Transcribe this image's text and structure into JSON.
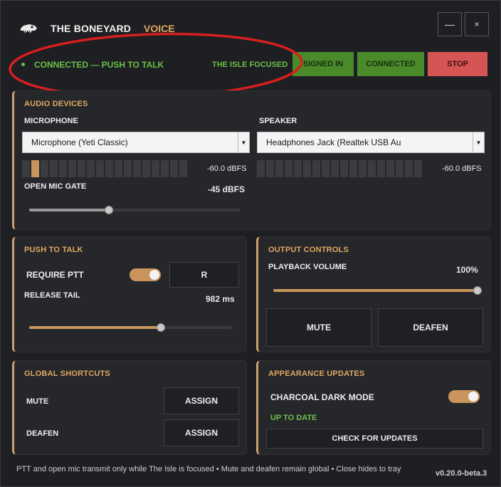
{
  "header": {
    "logo_icon": "dinosaur-skull-icon",
    "title": "THE BONEYARD",
    "subtitle": "VOICE",
    "minimize_label": "—",
    "close_label": "×"
  },
  "status": {
    "connection_text": "CONNECTED — PUSH TO TALK",
    "focus_text": "THE ISLE FOCUSED",
    "signed_in_label": "SIGNED IN",
    "connected_label": "CONNECTED",
    "stop_label": "STOP"
  },
  "audio_devices": {
    "title": "AUDIO DEVICES",
    "microphone_label": "MICROPHONE",
    "microphone_value": "Microphone (Yeti Classic)",
    "speaker_label": "SPEAKER",
    "speaker_value": "Headphones Jack (Realtek USB Au",
    "mic_level_text": "-60.0 dBFS",
    "mic_meter_active_segments": 1,
    "mic_meter_total_segments": 18,
    "speaker_level_text": "-60.0 dBFS",
    "speaker_meter_active_segments": 0,
    "speaker_meter_total_segments": 18,
    "gate_label": "OPEN MIC GATE",
    "gate_value": "-45 dBFS",
    "gate_fraction": 0.38
  },
  "push_to_talk": {
    "title": "PUSH TO TALK",
    "require_label": "REQUIRE PTT",
    "require_on": true,
    "key_label": "R",
    "tail_label": "RELEASE TAIL",
    "tail_value": "982 ms",
    "tail_fraction": 0.65
  },
  "output_controls": {
    "title": "OUTPUT  CONTROLS",
    "volume_label": "PLAYBACK VOLUME",
    "volume_value": "100%",
    "volume_fraction": 1.0,
    "mute_label": "MUTE",
    "deafen_label": "DEAFEN"
  },
  "shortcuts": {
    "title": "GLOBAL SHORTCUTS",
    "mute_label": "MUTE",
    "deafen_label": "DEAFEN",
    "assign_label": "ASSIGN"
  },
  "appearance": {
    "title": "APPEARANCE  UPDATES",
    "dark_mode_label": "CHARCOAL DARK MODE",
    "dark_mode_on": true,
    "update_status": "UP TO DATE",
    "check_label": "CHECK FOR UPDATES"
  },
  "footer": {
    "note": "PTT and open mic transmit only while The Isle is focused • Mute and deafen remain global • Close hides to tray",
    "version": "v0.20.0-beta.3"
  },
  "colors": {
    "accent": "#e0a862",
    "status_green": "#6cc04a",
    "stop_red": "#d55555",
    "annotation_red": "#d61f1f"
  }
}
